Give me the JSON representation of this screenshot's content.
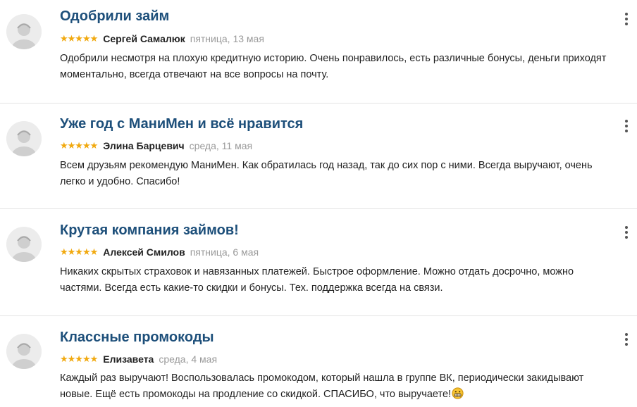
{
  "reviews": [
    {
      "title": "Одобрили займ",
      "stars": "★★★★★",
      "rating": 5,
      "author": "Сергей Самалюк",
      "date": "пятница, 13 мая",
      "text": "Одобрили несмотря на плохую кредитную историю. Очень понравилось, есть различные бонусы, деньги приходят моментально, всегда отвечают на все вопросы на почту.",
      "icon": "user-avatar-icon"
    },
    {
      "title": "Уже год с МаниМен и всё нравится",
      "stars": "★★★★★",
      "rating": 5,
      "author": "Элина Барцевич",
      "date": "среда, 11 мая",
      "text": "Всем друзьям рекомендую МаниМен. Как обратилась год назад, так до сих пор с ними. Всегда выручают, очень легко и удобно. Спасибо!",
      "icon": "user-avatar-icon"
    },
    {
      "title": "Крутая компания займов!",
      "stars": "★★★★★",
      "rating": 5,
      "author": "Алексей Смилов",
      "date": "пятница, 6 мая",
      "text": "Никаких скрытых страховок и навязанных платежей. Быстрое оформление. Можно отдать досрочно, можно частями. Всегда есть какие-то скидки и бонусы. Тех. поддержка всегда на связи.",
      "icon": "user-avatar-icon"
    },
    {
      "title": "Классные промокоды",
      "stars": "★★★★★",
      "rating": 5,
      "author": "Елизавета",
      "date": "среда, 4 мая",
      "text": "Каждый раз выручают! Воспользовалась промокодом, который нашла в группе ВК, периодически закидывают новые. Ещё есть промокоды на продление со скидкой. СПАСИБО, что выручаете!",
      "trailing_icon": "grinning-emoji-icon",
      "icon": "user-avatar-icon"
    }
  ],
  "menu_icon": "more-vertical-icon",
  "colors": {
    "title": "#1d4f7a",
    "stars": "#f1a90f",
    "date": "#9a9a9a",
    "divider": "#e4e4e4"
  }
}
